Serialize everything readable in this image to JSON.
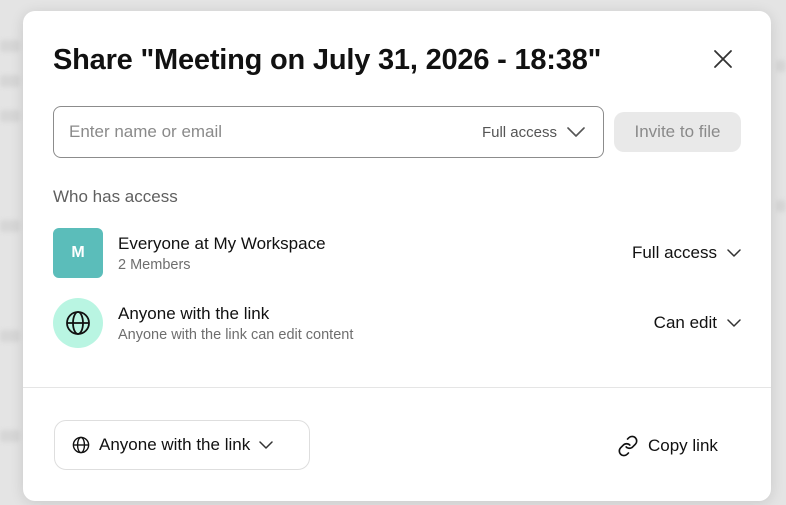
{
  "dialog": {
    "title": "Share \"Meeting on July 31, 2026 - 18:38\"",
    "close_icon": "close-icon"
  },
  "invite": {
    "placeholder": "Enter name or email",
    "value": "",
    "access_level": "Full access",
    "invite_button": "Invite to file"
  },
  "access": {
    "section_label": "Who has access",
    "entries": [
      {
        "avatar_text": "M",
        "avatar_color": "#5bbdba",
        "name": "Everyone at My Workspace",
        "subtitle": "2 Members",
        "role": "Full access"
      },
      {
        "icon": "globe-icon",
        "avatar_color": "#b9f5e2",
        "name": "Anyone with the link",
        "subtitle": "Anyone with the link can edit content",
        "role": "Can edit"
      }
    ]
  },
  "footer": {
    "link_scope": "Anyone with the link",
    "copy_link": "Copy link"
  }
}
